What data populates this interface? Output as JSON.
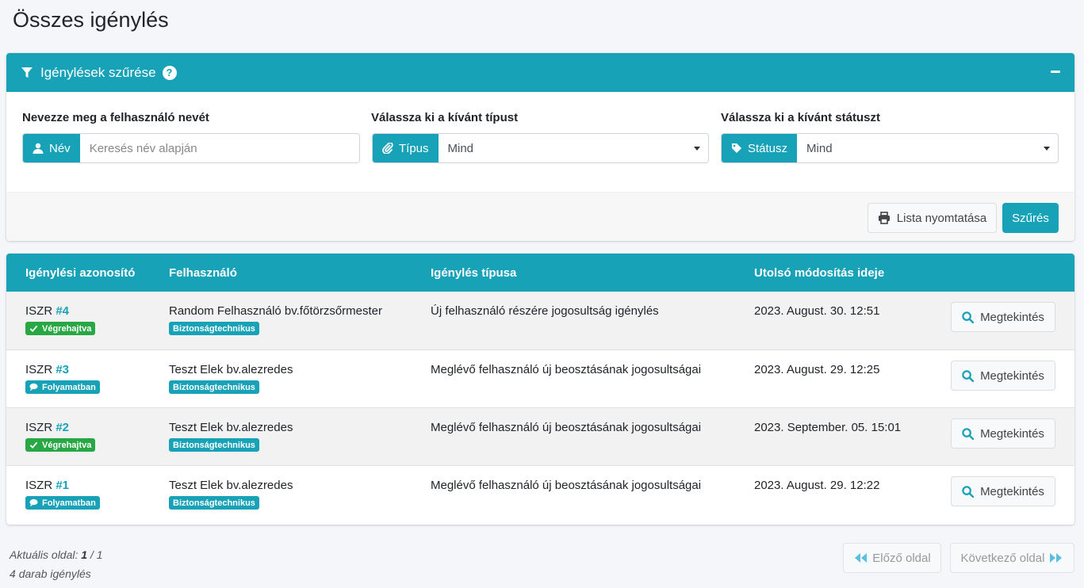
{
  "page_title": "Összes igénylés",
  "filter": {
    "header_title": "Igénylések szűrése",
    "help_glyph": "?",
    "name": {
      "label": "Nevezze meg a felhasználó nevét",
      "prefix": "Név",
      "placeholder": "Keresés név alapján",
      "value": ""
    },
    "type": {
      "label": "Válassza ki a kívánt típust",
      "prefix": "Típus",
      "selected": "Mind"
    },
    "status": {
      "label": "Válassza ki a kívánt státuszt",
      "prefix": "Státusz",
      "selected": "Mind"
    },
    "print_label": "Lista nyomtatása",
    "filter_label": "Szűrés"
  },
  "table": {
    "headers": [
      "Igénylési azonosító",
      "Felhasználó",
      "Igénylés típusa",
      "Utolsó módosítás ideje"
    ],
    "view_label": "Megtekintés",
    "rows": [
      {
        "prefix": "ISZR",
        "id": "#4",
        "status": "Végrehajtva",
        "status_kind": "success",
        "user": "Random Felhasználó bv.főtörzsőrmester",
        "role": "Biztonságtechnikus",
        "type": "Új felhasználó részére jogosultság igénylés",
        "modified": "2023. August. 30. 12:51"
      },
      {
        "prefix": "ISZR",
        "id": "#3",
        "status": "Folyamatban",
        "status_kind": "info",
        "user": "Teszt Elek bv.alezredes",
        "role": "Biztonságtechnikus",
        "type": "Meglévő felhasználó új beosztásának jogosultságai",
        "modified": "2023. August. 29. 12:25"
      },
      {
        "prefix": "ISZR",
        "id": "#2",
        "status": "Végrehajtva",
        "status_kind": "success",
        "user": "Teszt Elek bv.alezredes",
        "role": "Biztonságtechnikus",
        "type": "Meglévő felhasználó új beosztásának jogosultságai",
        "modified": "2023. September. 05. 15:01"
      },
      {
        "prefix": "ISZR",
        "id": "#1",
        "status": "Folyamatban",
        "status_kind": "info",
        "user": "Teszt Elek bv.alezredes",
        "role": "Biztonságtechnikus",
        "type": "Meglévő felhasználó új beosztásának jogosultságai",
        "modified": "2023. August. 29. 12:22"
      }
    ]
  },
  "pager": {
    "current_label": "Aktuális oldal:",
    "current_page": "1",
    "separator": "/",
    "total_pages": "1",
    "count": "4",
    "count_label": "darab igénylés",
    "prev_label": "Előző oldal",
    "next_label": "Következő oldal"
  },
  "colors": {
    "accent": "#17a2b8",
    "success": "#28a745",
    "background": "#f4f6f9"
  }
}
